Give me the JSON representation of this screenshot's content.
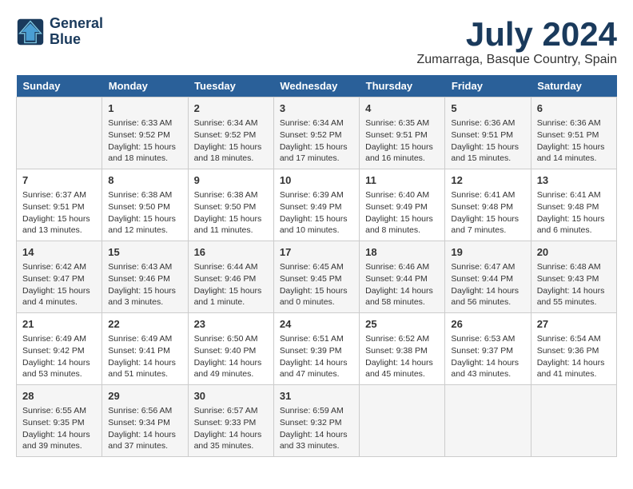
{
  "header": {
    "logo_line1": "General",
    "logo_line2": "Blue",
    "month_title": "July 2024",
    "location": "Zumarraga, Basque Country, Spain"
  },
  "calendar": {
    "days_of_week": [
      "Sunday",
      "Monday",
      "Tuesday",
      "Wednesday",
      "Thursday",
      "Friday",
      "Saturday"
    ],
    "weeks": [
      [
        {
          "day": "",
          "content": ""
        },
        {
          "day": "1",
          "content": "Sunrise: 6:33 AM\nSunset: 9:52 PM\nDaylight: 15 hours and 18 minutes."
        },
        {
          "day": "2",
          "content": "Sunrise: 6:34 AM\nSunset: 9:52 PM\nDaylight: 15 hours and 18 minutes."
        },
        {
          "day": "3",
          "content": "Sunrise: 6:34 AM\nSunset: 9:52 PM\nDaylight: 15 hours and 17 minutes."
        },
        {
          "day": "4",
          "content": "Sunrise: 6:35 AM\nSunset: 9:51 PM\nDaylight: 15 hours and 16 minutes."
        },
        {
          "day": "5",
          "content": "Sunrise: 6:36 AM\nSunset: 9:51 PM\nDaylight: 15 hours and 15 minutes."
        },
        {
          "day": "6",
          "content": "Sunrise: 6:36 AM\nSunset: 9:51 PM\nDaylight: 15 hours and 14 minutes."
        }
      ],
      [
        {
          "day": "7",
          "content": "Sunrise: 6:37 AM\nSunset: 9:51 PM\nDaylight: 15 hours and 13 minutes."
        },
        {
          "day": "8",
          "content": "Sunrise: 6:38 AM\nSunset: 9:50 PM\nDaylight: 15 hours and 12 minutes."
        },
        {
          "day": "9",
          "content": "Sunrise: 6:38 AM\nSunset: 9:50 PM\nDaylight: 15 hours and 11 minutes."
        },
        {
          "day": "10",
          "content": "Sunrise: 6:39 AM\nSunset: 9:49 PM\nDaylight: 15 hours and 10 minutes."
        },
        {
          "day": "11",
          "content": "Sunrise: 6:40 AM\nSunset: 9:49 PM\nDaylight: 15 hours and 8 minutes."
        },
        {
          "day": "12",
          "content": "Sunrise: 6:41 AM\nSunset: 9:48 PM\nDaylight: 15 hours and 7 minutes."
        },
        {
          "day": "13",
          "content": "Sunrise: 6:41 AM\nSunset: 9:48 PM\nDaylight: 15 hours and 6 minutes."
        }
      ],
      [
        {
          "day": "14",
          "content": "Sunrise: 6:42 AM\nSunset: 9:47 PM\nDaylight: 15 hours and 4 minutes."
        },
        {
          "day": "15",
          "content": "Sunrise: 6:43 AM\nSunset: 9:46 PM\nDaylight: 15 hours and 3 minutes."
        },
        {
          "day": "16",
          "content": "Sunrise: 6:44 AM\nSunset: 9:46 PM\nDaylight: 15 hours and 1 minute."
        },
        {
          "day": "17",
          "content": "Sunrise: 6:45 AM\nSunset: 9:45 PM\nDaylight: 15 hours and 0 minutes."
        },
        {
          "day": "18",
          "content": "Sunrise: 6:46 AM\nSunset: 9:44 PM\nDaylight: 14 hours and 58 minutes."
        },
        {
          "day": "19",
          "content": "Sunrise: 6:47 AM\nSunset: 9:44 PM\nDaylight: 14 hours and 56 minutes."
        },
        {
          "day": "20",
          "content": "Sunrise: 6:48 AM\nSunset: 9:43 PM\nDaylight: 14 hours and 55 minutes."
        }
      ],
      [
        {
          "day": "21",
          "content": "Sunrise: 6:49 AM\nSunset: 9:42 PM\nDaylight: 14 hours and 53 minutes."
        },
        {
          "day": "22",
          "content": "Sunrise: 6:49 AM\nSunset: 9:41 PM\nDaylight: 14 hours and 51 minutes."
        },
        {
          "day": "23",
          "content": "Sunrise: 6:50 AM\nSunset: 9:40 PM\nDaylight: 14 hours and 49 minutes."
        },
        {
          "day": "24",
          "content": "Sunrise: 6:51 AM\nSunset: 9:39 PM\nDaylight: 14 hours and 47 minutes."
        },
        {
          "day": "25",
          "content": "Sunrise: 6:52 AM\nSunset: 9:38 PM\nDaylight: 14 hours and 45 minutes."
        },
        {
          "day": "26",
          "content": "Sunrise: 6:53 AM\nSunset: 9:37 PM\nDaylight: 14 hours and 43 minutes."
        },
        {
          "day": "27",
          "content": "Sunrise: 6:54 AM\nSunset: 9:36 PM\nDaylight: 14 hours and 41 minutes."
        }
      ],
      [
        {
          "day": "28",
          "content": "Sunrise: 6:55 AM\nSunset: 9:35 PM\nDaylight: 14 hours and 39 minutes."
        },
        {
          "day": "29",
          "content": "Sunrise: 6:56 AM\nSunset: 9:34 PM\nDaylight: 14 hours and 37 minutes."
        },
        {
          "day": "30",
          "content": "Sunrise: 6:57 AM\nSunset: 9:33 PM\nDaylight: 14 hours and 35 minutes."
        },
        {
          "day": "31",
          "content": "Sunrise: 6:59 AM\nSunset: 9:32 PM\nDaylight: 14 hours and 33 minutes."
        },
        {
          "day": "",
          "content": ""
        },
        {
          "day": "",
          "content": ""
        },
        {
          "day": "",
          "content": ""
        }
      ]
    ]
  }
}
